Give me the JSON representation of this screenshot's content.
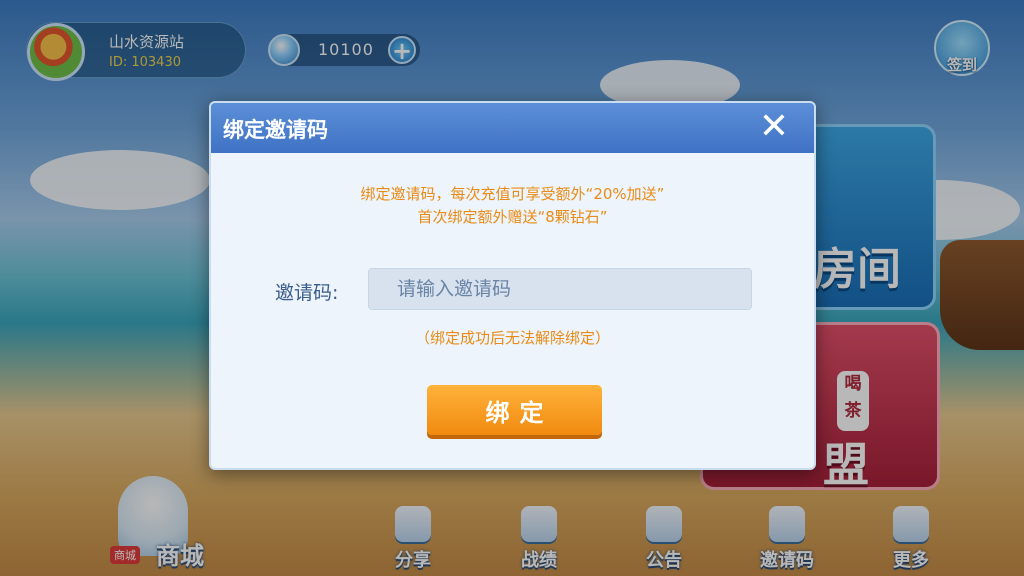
{
  "user": {
    "name": "山水资源站",
    "id_text": "ID: 103430"
  },
  "currency": {
    "amount": "10100",
    "add_symbol": "+"
  },
  "signin": {
    "label": "签到"
  },
  "background_panels": {
    "room_text": "房间",
    "league_text": "盟",
    "tea_text": "喝茶"
  },
  "dialog": {
    "title": "绑定邀请码",
    "close_symbol": "✕",
    "promo_line1": "绑定邀请码，每次充值可享受额外“20%加送”",
    "promo_line2": "首次绑定额外赠送“8颗钻石”",
    "code_label": "邀请码:",
    "code_placeholder": "请输入邀请码",
    "code_value": "",
    "note": "（绑定成功后无法解除绑定）",
    "bind_button": "绑定"
  },
  "bottom_nav": {
    "shop": {
      "label": "商城",
      "badge": "商城"
    },
    "items": [
      {
        "label": "分享",
        "icon": "share-icon"
      },
      {
        "label": "战绩",
        "icon": "trophy-icon"
      },
      {
        "label": "公告",
        "icon": "megaphone-icon"
      },
      {
        "label": "邀请码",
        "icon": "invite-icon"
      },
      {
        "label": "更多",
        "icon": "grid-icon"
      }
    ]
  },
  "colors": {
    "accent_orange": "#f18a10",
    "dialog_header": "#4a7fcc",
    "promo_text": "#e98b16"
  }
}
